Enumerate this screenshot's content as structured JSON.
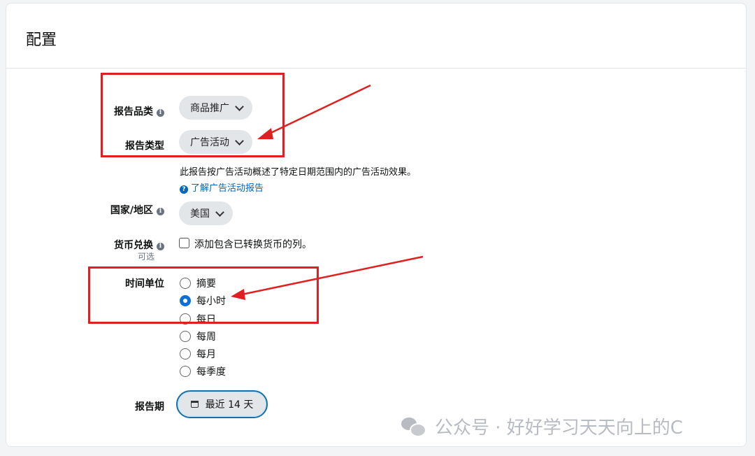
{
  "page": {
    "title": "配置"
  },
  "fields": {
    "report_category": {
      "label": "报告品类",
      "value": "商品推广"
    },
    "report_type": {
      "label": "报告类型",
      "value": "广告活动",
      "description": "此报告按广告活动概述了特定日期范围内的广告活动效果。",
      "learn_more": "了解广告活动报告"
    },
    "country": {
      "label": "国家/地区",
      "value": "美国"
    },
    "currency": {
      "label": "货币兑换",
      "optional": "可选",
      "checkbox_label": "添加包含已转换货币的列。",
      "checked": false
    },
    "time_unit": {
      "label": "时间单位",
      "options": [
        "摘要",
        "每小时",
        "每日",
        "每周",
        "每月",
        "每季度"
      ],
      "selected": "每小时"
    },
    "report_period": {
      "label": "报告期",
      "value": "最近 14 天"
    }
  },
  "icons": {
    "info": "info-icon",
    "help": "question-circle-icon",
    "dropdown": "chevron-down-icon",
    "calendar": "calendar-icon"
  },
  "colors": {
    "accent": "#0a6fd6",
    "link": "#0066c0",
    "annotation": "#e02020"
  },
  "watermark": "公众号 · 好好学习天天向上的C"
}
